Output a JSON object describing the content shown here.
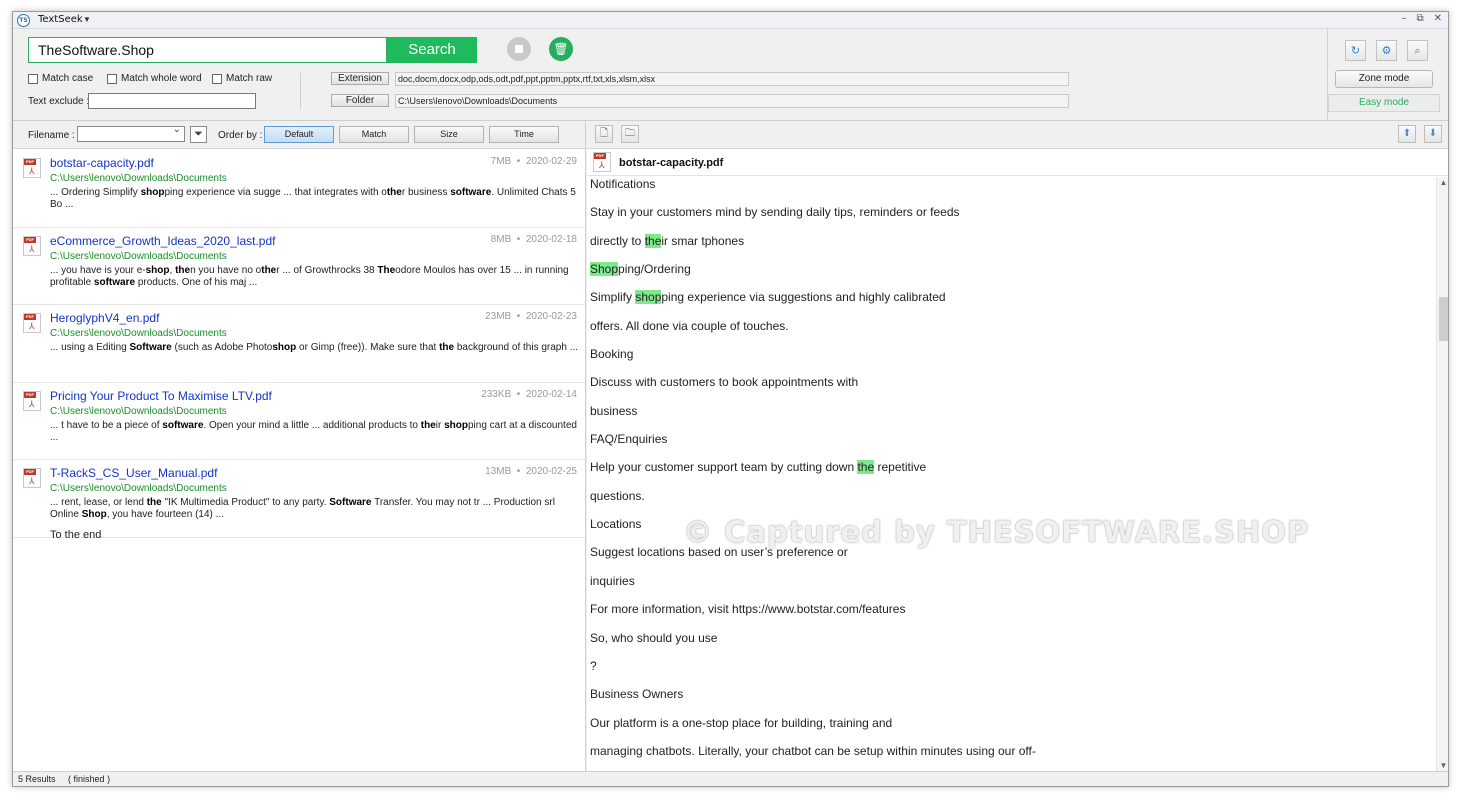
{
  "app": {
    "title": "TextSeek",
    "icon_text": "TS"
  },
  "window_controls": {
    "minimize": "–",
    "restore": "⧉",
    "close": "✕"
  },
  "search": {
    "query": "TheSoftware.Shop",
    "button_label": "Search",
    "stop_icon": "stop-icon",
    "trash_icon": "trash-icon"
  },
  "options": {
    "match_case": "Match case",
    "match_whole_word": "Match whole word",
    "match_raw": "Match raw",
    "text_exclude_label": "Text exclude :",
    "text_exclude_value": ""
  },
  "filters": {
    "extension_label": "Extension",
    "extension_value": "doc,docm,docx,odp,ods,odt,pdf,ppt,pptm,pptx,rtf,txt,xls,xlsm,xlsx",
    "folder_label": "Folder",
    "folder_value": "C:\\Users\\lenovo\\Downloads\\Documents"
  },
  "tools": {
    "zone_mode": "Zone mode",
    "easy_mode": "Easy mode",
    "refresh_icon": "↻",
    "settings_icon": "⚙",
    "search_icon": "⌕"
  },
  "list_controls": {
    "filename_label": "Filename :",
    "filename_value": "",
    "order_by_label": "Order by :",
    "order_buttons": [
      "Default",
      "Match",
      "Size",
      "Time"
    ],
    "active_order": "Default"
  },
  "results": [
    {
      "title": "botstar-capacity.pdf",
      "size": "7MB",
      "date": "2020-02-29",
      "path": "C:\\Users\\lenovo\\Downloads\\Documents",
      "snippet": [
        "... Ordering Simplify ",
        "<b>shop</b>",
        "ping experience via sugge ... that integrates with o",
        "<b>the</b>",
        "r business ",
        "<b>software</b>",
        ". Unlimited Chats 5 Bo ..."
      ]
    },
    {
      "title": "eCommerce_Growth_Ideas_2020_last.pdf",
      "size": "8MB",
      "date": "2020-02-18",
      "path": "C:\\Users\\lenovo\\Downloads\\Documents",
      "snippet": [
        "... you have is your e-",
        "<b>shop</b>",
        ", ",
        "<b>the</b>",
        "n you have no o",
        "<b>the</b>",
        "r ... of Growthrocks 38 ",
        "<b>The</b>",
        "odore Moulos has over 15 ... in running profitable ",
        "<b>software</b>",
        " products. One of his maj ..."
      ]
    },
    {
      "title": "HeroglyphV4_en.pdf",
      "size": "23MB",
      "date": "2020-02-23",
      "path": "C:\\Users\\lenovo\\Downloads\\Documents",
      "snippet": [
        "... using a Editing ",
        "<b>Software</b>",
        " (such as Adobe Photo",
        "<b>shop</b>",
        " or Gimp (free)). Make sure that ",
        "<b>the</b>",
        " background of this graph ..."
      ]
    },
    {
      "title": "Pricing Your Product To Maximise LTV.pdf",
      "size": "233KB",
      "date": "2020-02-14",
      "path": "C:\\Users\\lenovo\\Downloads\\Documents",
      "snippet": [
        "... t have to be a piece of ",
        "<b>software</b>",
        ". Open your mind a little ... additional products to ",
        "<b>the</b>",
        "ir ",
        "<b>shop</b>",
        "ping cart at a discounted ..."
      ]
    },
    {
      "title": "T-RackS_CS_User_Manual.pdf",
      "size": "13MB",
      "date": "2020-02-25",
      "path": "C:\\Users\\lenovo\\Downloads\\Documents",
      "snippet": [
        "... rent, lease, or lend ",
        "<b>the</b>",
        " \"IK Multimedia Product\" to any party. ",
        "<b>Software</b>",
        " Transfer. You may not tr ... Production srl Online ",
        "<b>Shop</b>",
        ", you have fourteen (14) ..."
      ]
    }
  ],
  "end_marker": "To the end",
  "preview": {
    "file_name": "botstar-capacity.pdf",
    "lines": [
      [
        "Notifications"
      ],
      [
        "Stay in your customers mind by sending daily tips, reminders or feeds"
      ],
      [
        "directly to ",
        "<hl>the</hl>",
        "ir smar tphones"
      ],
      [
        "<hl>Shop</hl>",
        "ping/Ordering"
      ],
      [
        "Simplify ",
        "<hl>shop</hl>",
        "ping experience via suggestions and highly calibrated"
      ],
      [
        "offers. All done via couple of touches."
      ],
      [
        "Booking"
      ],
      [
        "Discuss with customers to book appointments with"
      ],
      [
        "business"
      ],
      [
        "FAQ/Enquiries"
      ],
      [
        "Help your customer support team by cutting down ",
        "<hl>the</hl>",
        " repetitive"
      ],
      [
        "questions."
      ],
      [
        "Locations"
      ],
      [
        "Suggest locations based on user’s preference or"
      ],
      [
        "inquiries"
      ],
      [
        "For more information, visit https://www.botstar.com/features"
      ],
      [
        "So, who should you use"
      ],
      [
        "?"
      ],
      [
        "Business Owners"
      ],
      [
        "Our platform is a one-stop place for building, training and"
      ],
      [
        "managing chatbots. Literally, your chatbot can be setup within minutes using our off-"
      ]
    ]
  },
  "watermark": "© Captured by THESOFTWARE.SHOP",
  "status": {
    "count": "5 Results",
    "state": "( finished )"
  }
}
